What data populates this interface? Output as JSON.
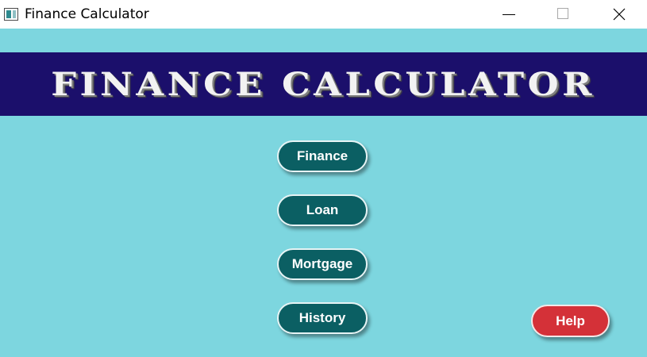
{
  "window": {
    "title": "Finance Calculator",
    "controls": [
      "minimize",
      "maximize",
      "close"
    ]
  },
  "banner": {
    "text": "Finance Calculator"
  },
  "nav": {
    "finance_label": "Finance",
    "loan_label": "Loan",
    "mortgage_label": "Mortgage",
    "history_label": "History"
  },
  "help": {
    "label": "Help"
  },
  "colors": {
    "background": "#7dd6df",
    "banner": "#1b0f6b",
    "nav_button": "#0b5f63",
    "help_button": "#d43138"
  },
  "icons": {
    "app": "app-icon",
    "minimize": "minimize-icon",
    "maximize": "maximize-icon",
    "close": "close-icon"
  }
}
